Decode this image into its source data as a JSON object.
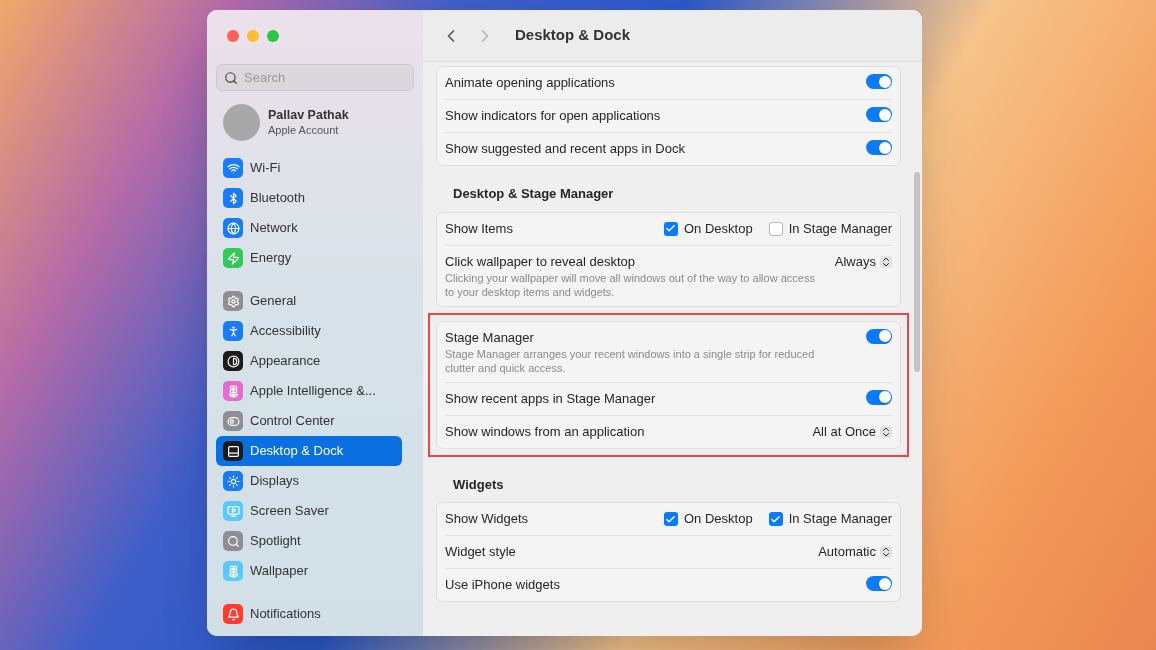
{
  "window": {
    "title": "Desktop & Dock"
  },
  "search": {
    "placeholder": "Search"
  },
  "account": {
    "name": "Pallav Pathak",
    "subtitle": "Apple Account"
  },
  "sidebar": {
    "groups": [
      [
        {
          "label": "Wi-Fi",
          "color": "#1a7cf5",
          "selected": false
        },
        {
          "label": "Bluetooth",
          "color": "#1a7cf5",
          "selected": false
        },
        {
          "label": "Network",
          "color": "#1a7cf5",
          "selected": false
        },
        {
          "label": "Energy",
          "color": "#34c759",
          "selected": false
        }
      ],
      [
        {
          "label": "General",
          "color": "#8e8e93",
          "selected": false
        },
        {
          "label": "Accessibility",
          "color": "#1a7cf5",
          "selected": false
        },
        {
          "label": "Appearance",
          "color": "#1c1c1e",
          "selected": false
        },
        {
          "label": "Apple Intelligence &...",
          "color": "#e46bd0",
          "selected": false
        },
        {
          "label": "Control Center",
          "color": "#8e8e93",
          "selected": false
        },
        {
          "label": "Desktop & Dock",
          "color": "#1c1c1e",
          "selected": true
        },
        {
          "label": "Displays",
          "color": "#1a7cf5",
          "selected": false
        },
        {
          "label": "Screen Saver",
          "color": "#5ac8fa",
          "selected": false
        },
        {
          "label": "Spotlight",
          "color": "#8e8e93",
          "selected": false
        },
        {
          "label": "Wallpaper",
          "color": "#5ac8fa",
          "selected": false
        }
      ],
      [
        {
          "label": "Notifications",
          "color": "#ff3b30",
          "selected": false
        }
      ]
    ]
  },
  "sections": [
    {
      "highlighted": false,
      "rows": [
        {
          "kind": "toggle",
          "label": "Animate opening applications",
          "on": true
        },
        {
          "kind": "toggle",
          "label": "Show indicators for open applications",
          "on": true
        },
        {
          "kind": "toggle",
          "label": "Show suggested and recent apps in Dock",
          "on": true
        }
      ]
    },
    {
      "heading": "Desktop & Stage Manager",
      "highlighted": false,
      "rows": [
        {
          "kind": "checks",
          "label": "Show Items",
          "options": [
            {
              "label": "On Desktop",
              "checked": true
            },
            {
              "label": "In Stage Manager",
              "checked": false
            }
          ]
        },
        {
          "kind": "popup",
          "label": "Click wallpaper to reveal desktop",
          "description": "Clicking your wallpaper will move all windows out of the way to allow access to your desktop items and widgets.",
          "value": "Always"
        }
      ]
    },
    {
      "highlighted": true,
      "rows": [
        {
          "kind": "toggle",
          "label": "Stage Manager",
          "description": "Stage Manager arranges your recent windows into a single strip for reduced clutter and quick access.",
          "on": true
        },
        {
          "kind": "toggle",
          "label": "Show recent apps in Stage Manager",
          "on": true
        },
        {
          "kind": "popup",
          "label": "Show windows from an application",
          "value": "All at Once"
        }
      ]
    },
    {
      "heading": "Widgets",
      "highlighted": false,
      "rows": [
        {
          "kind": "checks",
          "label": "Show Widgets",
          "options": [
            {
              "label": "On Desktop",
              "checked": true
            },
            {
              "label": "In Stage Manager",
              "checked": true
            }
          ]
        },
        {
          "kind": "popup",
          "label": "Widget style",
          "value": "Automatic"
        },
        {
          "kind": "toggle",
          "label": "Use iPhone widgets",
          "on": true
        }
      ]
    }
  ]
}
